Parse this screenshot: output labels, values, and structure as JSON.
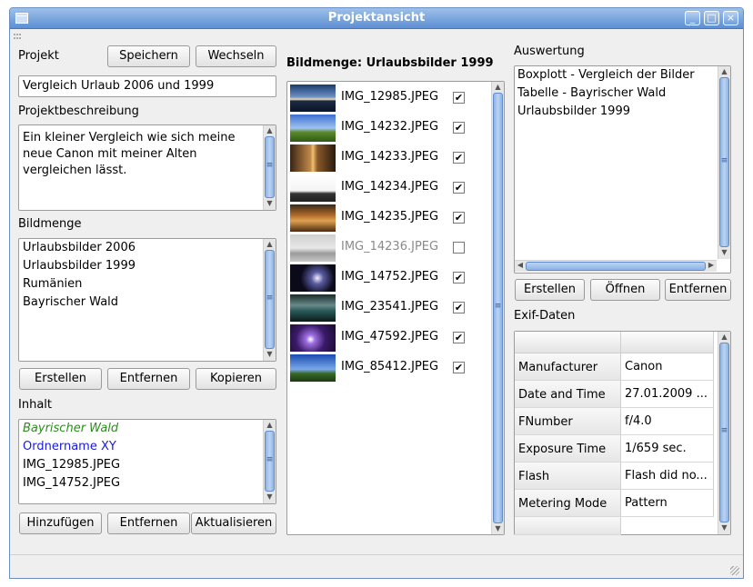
{
  "window": {
    "title": "Projektansicht"
  },
  "projekt": {
    "label": "Projekt",
    "save_button": "Speichern",
    "switch_button": "Wechseln",
    "name_value": "Vergleich Urlaub 2006 und 1999",
    "desc_label": "Projektbeschreibung",
    "desc_lines": [
      "Ein kleiner Vergleich wie sich meine",
      "neue Canon mit meiner Alten",
      "vergleichen lässt."
    ]
  },
  "bildmenge": {
    "label": "Bildmenge",
    "items": [
      "Urlaubsbilder 2006",
      "Urlaubsbilder 1999",
      "Rumänien",
      "Bayrischer Wald"
    ],
    "buttons": {
      "create": "Erstellen",
      "remove": "Entfernen",
      "copy": "Kopieren"
    }
  },
  "inhalt": {
    "label": "Inhalt",
    "items": [
      {
        "text": "Bayrischer Wald",
        "color": "#2e8b20"
      },
      {
        "text": "Ordnername XY",
        "color": "#1a1adc"
      },
      {
        "text": "IMG_12985.JPEG",
        "color": "#000000"
      },
      {
        "text": "IMG_14752.JPEG",
        "color": "#000000"
      }
    ],
    "buttons": {
      "add": "Hinzufügen",
      "remove": "Entfernen",
      "refresh": "Aktualisieren"
    }
  },
  "images": {
    "header": "Bildmenge: Urlaubsbilder 1999",
    "items": [
      {
        "name": "IMG_12985.JPEG",
        "checked": true,
        "thumb": "lake-sunset"
      },
      {
        "name": "IMG_14232.JPEG",
        "checked": true,
        "thumb": "tree-meadow"
      },
      {
        "name": "IMG_14233.JPEG",
        "checked": true,
        "thumb": "city-street"
      },
      {
        "name": "IMG_14234.JPEG",
        "checked": true,
        "thumb": "skyline"
      },
      {
        "name": "IMG_14235.JPEG",
        "checked": true,
        "thumb": "forest-autumn"
      },
      {
        "name": "IMG_14236.JPEG",
        "checked": false,
        "thumb": "grey-landscape"
      },
      {
        "name": "IMG_14752.JPEG",
        "checked": true,
        "thumb": "lightning-dark"
      },
      {
        "name": "IMG_23541.JPEG",
        "checked": true,
        "thumb": "coast"
      },
      {
        "name": "IMG_47592.JPEG",
        "checked": true,
        "thumb": "purple-lightning"
      },
      {
        "name": "IMG_85412.JPEG",
        "checked": true,
        "thumb": "tree-sky"
      }
    ]
  },
  "auswertung": {
    "label": "Auswertung",
    "items": [
      "Boxplott - Vergleich der Bilder",
      "Tabelle - Bayrischer Wald",
      "Urlaubsbilder 1999"
    ],
    "buttons": {
      "create": "Erstellen",
      "open": "Öffnen",
      "remove": "Entfernen"
    }
  },
  "exif": {
    "label": "Exif-Daten",
    "rows": [
      {
        "key": "Manufacturer",
        "value": "Canon"
      },
      {
        "key": "Date and Time",
        "value": "27.01.2009 ..."
      },
      {
        "key": "FNumber",
        "value": "f/4.0"
      },
      {
        "key": "Exposure Time",
        "value": "1/659 sec."
      },
      {
        "key": "Flash",
        "value": "Flash did no..."
      },
      {
        "key": "Metering Mode",
        "value": "Pattern"
      }
    ]
  }
}
